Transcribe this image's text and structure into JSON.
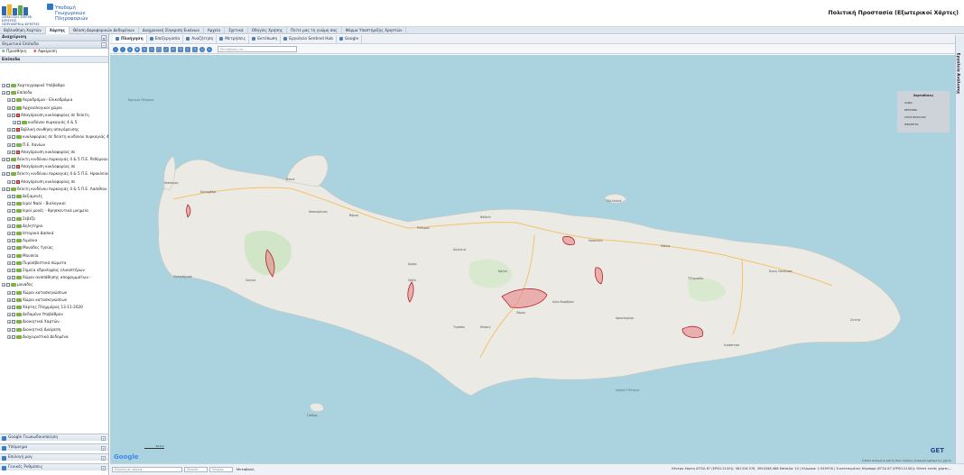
{
  "header": {
    "logo1_text": "ΔΗΜΟΣΙΟ ΠΕΡΙΦ. ΚΡΗΤΗΣ",
    "logo1_text2": "ΠΕΡΙΦΕΡΕΙΑ ΚΡΗΤΗΣ",
    "logo2_line1": "Υποδομή",
    "logo2_line2": "Γεωχωρικών",
    "logo2_line3": "Πληροφοριών",
    "app_title": "Πολιτική Προστασία (Εξωτερικοί Χάρτες)"
  },
  "tabs": [
    "Βιβλιοθήκη Χαρτών",
    "Χάρτης",
    "Θέαση Δορυφορικών Δεδομένων",
    "Διαχρονική Σύγκριση Εικόνων",
    "Αρχεία",
    "Σχετικά",
    "Οδηγίες Χρήσης",
    "Πείτε μας τη γνώμη σας",
    "Φόρμα Υποστήριξης Χρηστών"
  ],
  "left_panel": {
    "title": "Διαχείριση",
    "section": "Θεματικά Επίπεδα",
    "add_label": "Προσθήκη",
    "remove_label": "Αφαίρεση",
    "layers_header": "Επίπεδα",
    "tree": [
      {
        "label": "Χαρτογραφικό Υπόβαθρο",
        "level": 1
      },
      {
        "label": "Επίπεδα",
        "level": 1
      },
      {
        "label": "Αεροδρόμια - Ελικοδρόμια",
        "level": 2
      },
      {
        "label": "Αρχαιολογικοί χώροι",
        "level": 2
      },
      {
        "label": "Απαγόρευση κυκλοφορίας σε δείκτη",
        "level": 2
      },
      {
        "label": "κινδύνου πυρκαγιάς 4 & 5",
        "level": 3
      },
      {
        "label": "Βιβλική συνθήκη απαγόρευσης",
        "level": 2
      },
      {
        "label": "κυκλοφορίας σε δείκτη κινδύνου πυρκαγιάς 4 & 5",
        "level": 2
      },
      {
        "label": "Π.Ε. Χανίων",
        "level": 2
      },
      {
        "label": "Απαγόρευση κυκλοφορίας σε",
        "level": 2
      },
      {
        "label": "δείκτη κινδύνου πυρκαγιάς 4 & 5 Π.Ε. Ρεθύμνου",
        "level": 1
      },
      {
        "label": "Απαγόρευση κυκλοφορίας σε",
        "level": 2
      },
      {
        "label": "δείκτη κινδύνου πυρκαγιάς 4 & 5 Π.Ε. Ηρακλείου",
        "level": 1
      },
      {
        "label": "Απαγόρευση κυκλοφορίας σε",
        "level": 2
      },
      {
        "label": "δείκτη κινδύνου πυρκαγιάς 4 & 5 Π.Ε. Λασιθίου",
        "level": 1
      },
      {
        "label": "Δεξαμενές",
        "level": 2
      },
      {
        "label": "Ιεροί Ναοί - Βιολογικοί",
        "level": 2
      },
      {
        "label": "Ιεροί μονές - θρησκευτικά μνημεία",
        "level": 2
      },
      {
        "label": "Σεβέζε",
        "level": 2
      },
      {
        "label": "Δηλητήριο",
        "level": 2
      },
      {
        "label": "Ιστορικά Δασικά",
        "level": 2
      },
      {
        "label": "Λιμάνια",
        "level": 2
      },
      {
        "label": "Μονάδες Υγείας",
        "level": 2
      },
      {
        "label": "Μουσεία",
        "level": 2
      },
      {
        "label": "Πυροσβεστικά σώματα",
        "level": 2
      },
      {
        "label": "Σημεία υδροληψίας ελικοπτέρων",
        "level": 2
      },
      {
        "label": "Χώροι αναπάθησης απορριμμάτων -",
        "level": 2
      },
      {
        "label": "μονάδες",
        "level": 1
      },
      {
        "label": "Χώροι κατασκηνώσεων",
        "level": 2
      },
      {
        "label": "Χώροι κατασκηνώσεων",
        "level": 2
      },
      {
        "label": "Χάρτης Πλημμύρας 13-11-2020",
        "level": 2
      },
      {
        "label": "Δεδομένα Υποβάθρου",
        "level": 2
      },
      {
        "label": "Διοικητικά Χαρτών",
        "level": 2
      },
      {
        "label": "Διοικητική Διαίρεση",
        "level": 2
      },
      {
        "label": "Διαχειριστικά Δεδομένα",
        "level": 2
      }
    ],
    "bottom": [
      "Google Γεωκωδικοποίηση",
      "Υπόμνημα",
      "Επιλογή μαγ.",
      "Γενικές Ρυθμίσεις"
    ]
  },
  "map_toolbar": {
    "items": [
      "Πλοήγηση",
      "Επεξεργασία",
      "Αναζήτηση",
      "Μετρήσεις",
      "Εκτύπωση",
      "Εργαλείο Sentinel Hub",
      "Google"
    ],
    "search_placeholder": "Μετάβαση σε..."
  },
  "right_tab": "Εργαλεία Ανάλυσης",
  "legend": {
    "title": "Χαρτοθέσεις",
    "items": [
      "ΧΑΝΙΑ",
      "ΡΕΘΥΜΝΟ",
      "ΑΓΙΟΣ ΝΙΚΟΛΑΟΣ",
      "ΙΕΡΑΠΕΤΡΑ"
    ]
  },
  "map_labels": [
    {
      "t": "Κρητικό Πέλαγος",
      "k": "b"
    },
    {
      "t": "Λιβυκό Πέλαγος",
      "k": "b"
    },
    {
      "t": "Χανιά",
      "k": "c"
    },
    {
      "t": "Ρέθυμνο",
      "k": "c"
    },
    {
      "t": "Ηράκλειο",
      "k": "c"
    },
    {
      "t": "Άγιος Νικόλαος",
      "k": "c"
    },
    {
      "t": "Κρήτη",
      "k": "c"
    },
    {
      "t": "Μοίρες",
      "k": "c"
    },
    {
      "t": "Ιεράπετρα",
      "k": "c"
    },
    {
      "t": "Σητεία",
      "k": "c"
    },
    {
      "t": "Κίσσαμος",
      "k": "c"
    },
    {
      "t": "Σπήλι",
      "k": "c"
    },
    {
      "t": "Κολυμβάρι",
      "k": "c"
    },
    {
      "t": "Παλαιόχωρα",
      "k": "c"
    },
    {
      "t": "Σούγια",
      "k": "c"
    },
    {
      "t": "Φόδελε",
      "k": "c"
    },
    {
      "t": "Dia Island",
      "k": "c"
    },
    {
      "t": "Αγία Βαρβάρα",
      "k": "c"
    },
    {
      "t": "Ζάρος",
      "k": "c"
    },
    {
      "t": "Αρκαλοχώρι",
      "k": "c"
    },
    {
      "t": "Τυμπάκι",
      "k": "c"
    },
    {
      "t": "Μάλια",
      "k": "c"
    },
    {
      "t": "Βάμος",
      "k": "c"
    },
    {
      "t": "Αποκορώνας",
      "k": "c"
    },
    {
      "t": "Αμάρι",
      "k": "c"
    },
    {
      "t": "Ανώγεια",
      "k": "c"
    },
    {
      "t": "Τζερμιάδο",
      "k": "c"
    },
    {
      "t": "Γαύδος",
      "k": "c"
    }
  ],
  "status": {
    "search1_ph": "Εύρεση σε κάρτα",
    "search2_ph": "Σύνολο",
    "search3_ph": "Σύνολο",
    "label": "Μεταβολή",
    "coords": "Κέντρο Χάρτη (ΕΓΣΑ 87 (EPSG:2100)): 581316.576, 3904348.488 Επίπεδο: 10 | Κλίμακα: 1:545978 | Συντεταγμένες Κέρσορα (ΕΓΣΑ 87 (EPSG:2100)): Θέστε εκτός χάρτη..."
  },
  "map_footer": {
    "google": "Google",
    "get": "GET",
    "scale": "20 km",
    "attr": "©2021 Δεδομένα χάρτη    Όροι Χρήσης    Αναφορά σφάλματος χάρτη"
  }
}
